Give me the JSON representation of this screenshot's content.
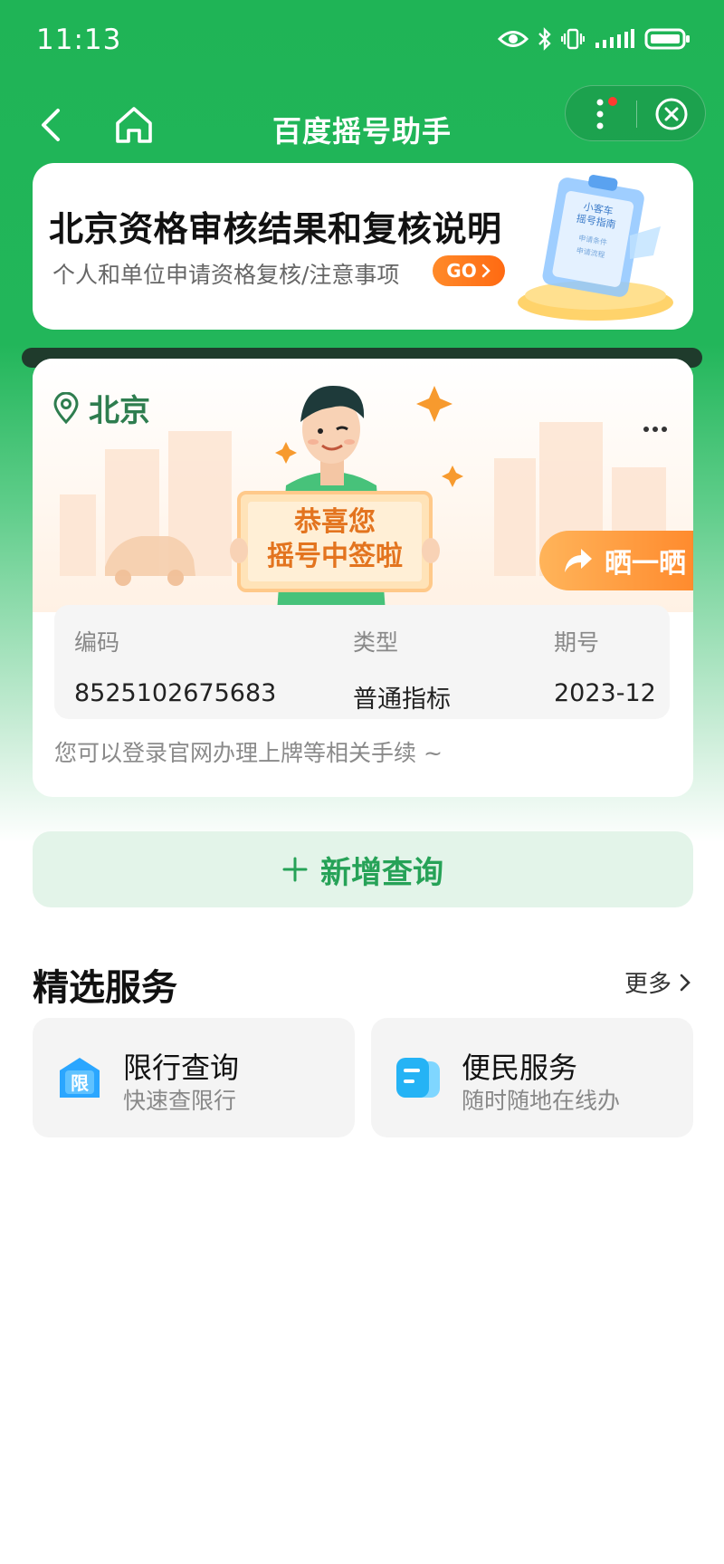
{
  "status_bar": {
    "time": "11:13"
  },
  "nav": {
    "title": "百度摇号助手"
  },
  "banner": {
    "title": "北京资格审核结果和复核说明",
    "subtitle": "个人和单位申请资格复核/注意事项",
    "go_label": "GO",
    "illustration_text": [
      "小客车",
      "摇号指南",
      "申请条件",
      "申请流程"
    ]
  },
  "result": {
    "location": "北京",
    "sign_line1": "恭喜您",
    "sign_line2": "摇号中签啦",
    "share_label": "晒一晒",
    "fields": [
      {
        "label": "编码",
        "value": "8525102675683"
      },
      {
        "label": "类型",
        "value": "普通指标"
      },
      {
        "label": "期号",
        "value": "2023-12"
      }
    ],
    "note": "您可以登录官网办理上牌等相关手续 ~"
  },
  "add_query": {
    "label": "新增查询"
  },
  "services": {
    "title": "精选服务",
    "more_label": "更多",
    "items": [
      {
        "name": "限行查询",
        "desc": "快速查限行",
        "icon_text": "限"
      },
      {
        "name": "便民服务",
        "desc": "随时随地在线办"
      }
    ]
  },
  "colors": {
    "brand_green": "#1fb456",
    "accent_orange": "#ff7a1a"
  }
}
